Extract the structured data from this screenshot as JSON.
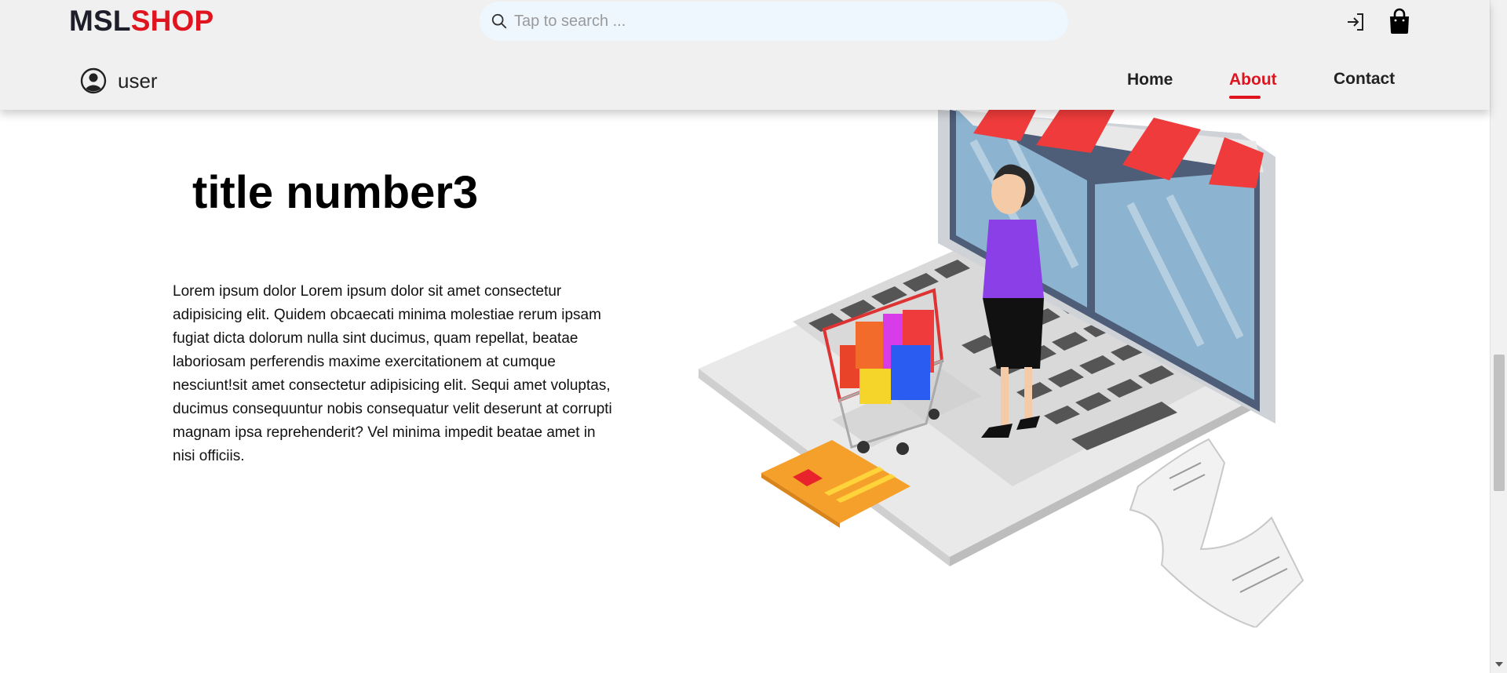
{
  "brand": {
    "part1": "MSL",
    "part2": "SHOP"
  },
  "search": {
    "placeholder": "Tap to search ..."
  },
  "header_icons": {
    "login": "login-icon",
    "cart": "shopping-bag-icon"
  },
  "user": {
    "label": "user",
    "icon": "user-circle-icon"
  },
  "nav": {
    "items": [
      {
        "label": "Home",
        "active": false
      },
      {
        "label": "About",
        "active": true
      },
      {
        "label": "Contact",
        "active": false
      }
    ]
  },
  "main": {
    "title": "title number3",
    "body": "Lorem ipsum dolor Lorem ipsum dolor sit amet consectetur adipisicing elit. Quidem obcaecati minima molestiae rerum ipsam fugiat dicta dolorum nulla sint ducimus, quam repellat, beatae laboriosam perferendis maxime exercitationem at cumque nesciunt!sit amet consectetur adipisicing elit. Sequi amet voluptas, ducimus consequuntur nobis consequatur velit deserunt at corrupti magnam ipsa reprehenderit? Vel minima impedit beatae amet in nisi officiis."
  },
  "colors": {
    "brand_dark": "#1e1e2a",
    "brand_accent": "#e0141e",
    "header_bg": "#f0f0f0",
    "search_bg": "#eef6fe"
  }
}
